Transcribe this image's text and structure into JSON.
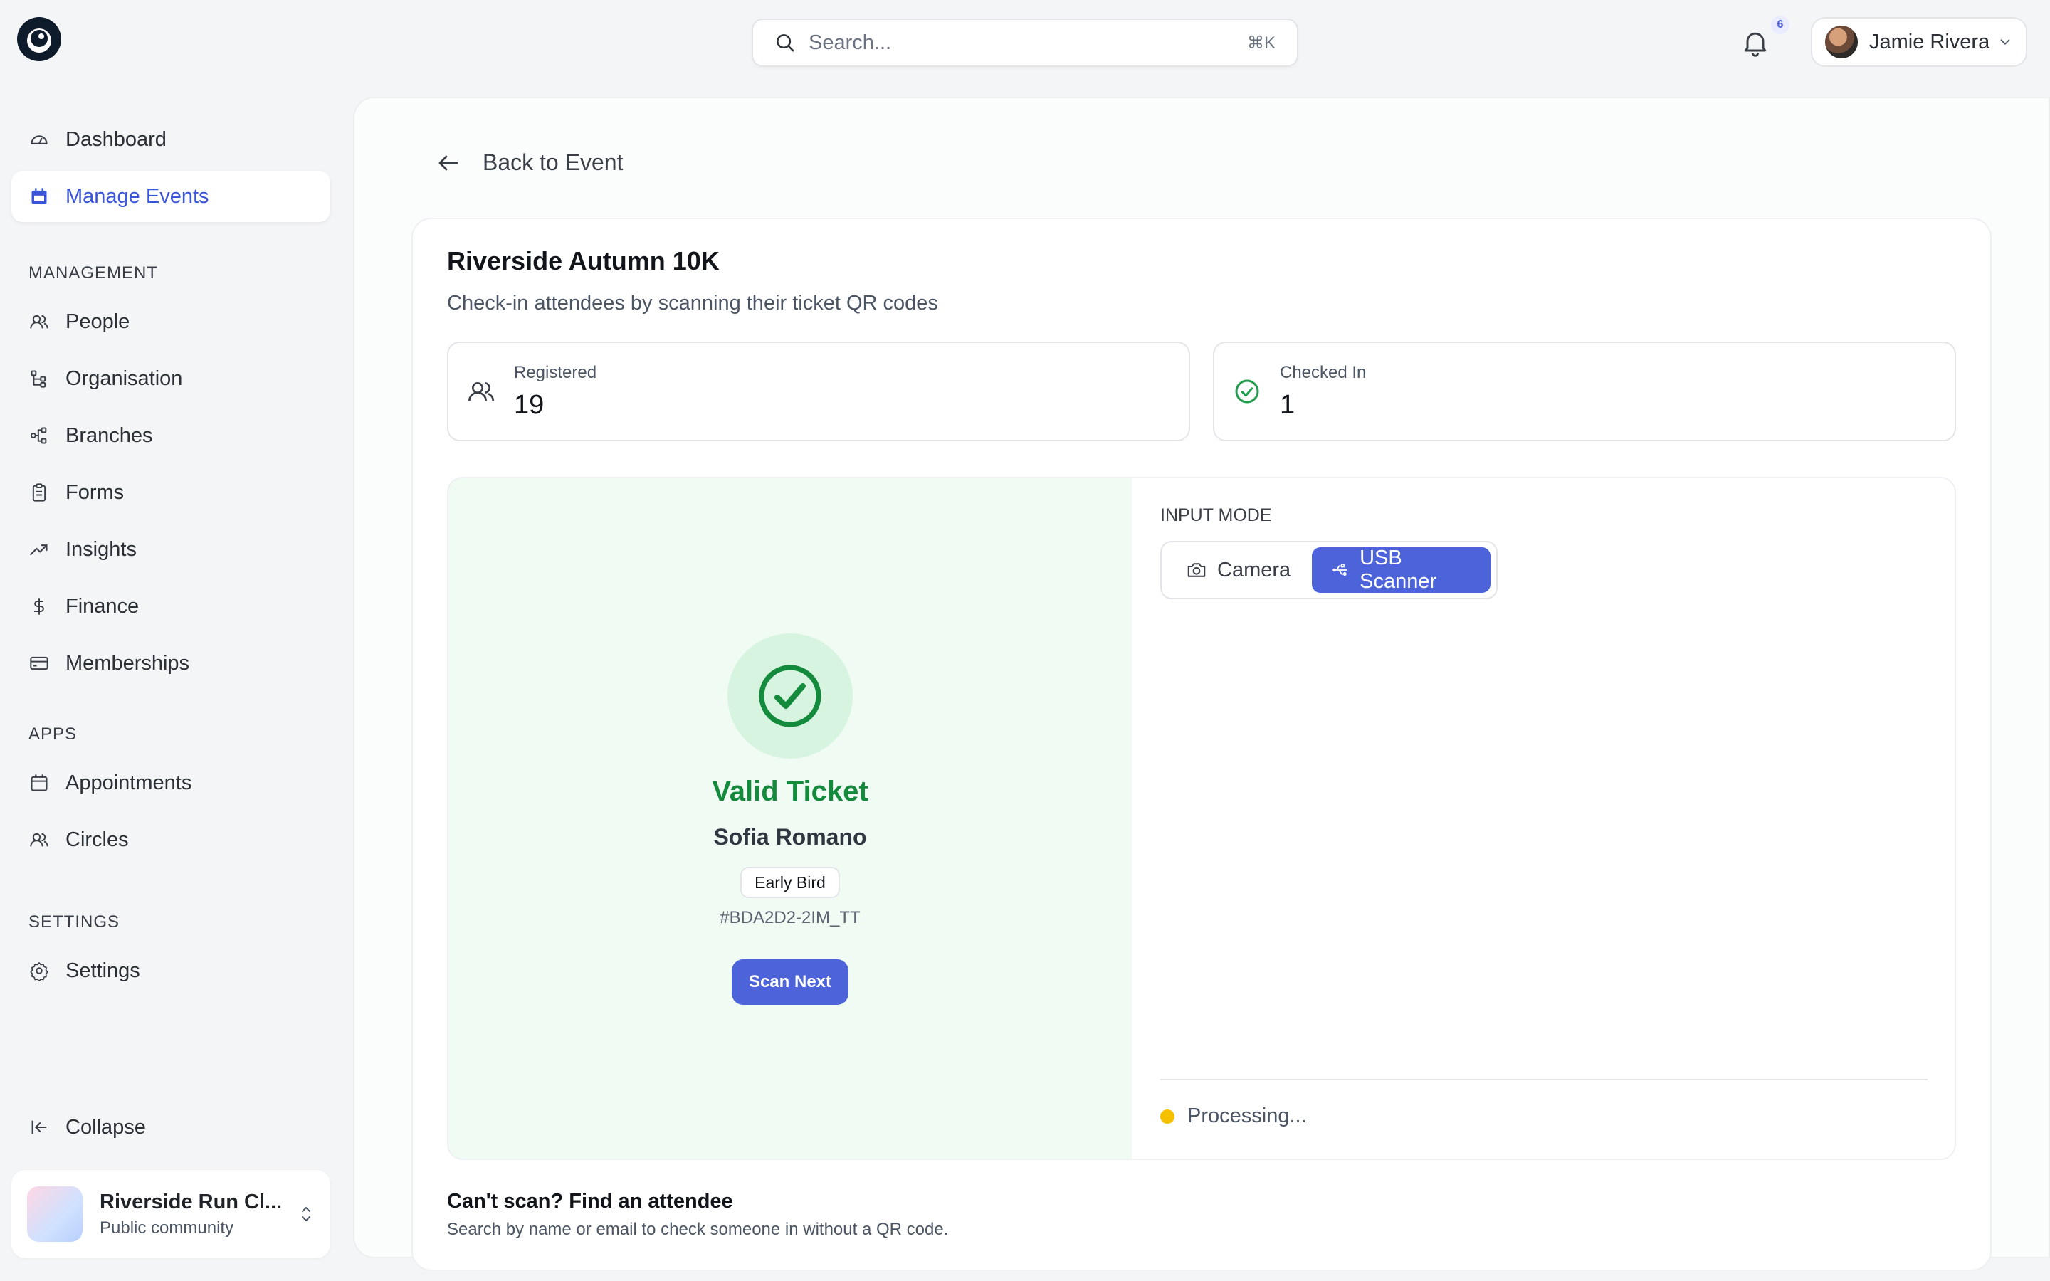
{
  "header": {
    "search_placeholder": "Search...",
    "search_shortcut": "⌘K",
    "notification_count": "6",
    "user_name": "Jamie Rivera"
  },
  "sidebar": {
    "top_items": [
      {
        "label": "Dashboard",
        "icon": "gauge-icon"
      },
      {
        "label": "Manage Events",
        "icon": "calendar-icon",
        "active": true
      }
    ],
    "sections": [
      {
        "title": "MANAGEMENT",
        "items": [
          {
            "label": "People",
            "icon": "users-icon"
          },
          {
            "label": "Organisation",
            "icon": "org-icon"
          },
          {
            "label": "Branches",
            "icon": "branches-icon"
          },
          {
            "label": "Forms",
            "icon": "clipboard-icon"
          },
          {
            "label": "Insights",
            "icon": "trend-icon"
          },
          {
            "label": "Finance",
            "icon": "dollar-icon"
          },
          {
            "label": "Memberships",
            "icon": "card-icon"
          }
        ]
      },
      {
        "title": "APPS",
        "items": [
          {
            "label": "Appointments",
            "icon": "calendar-icon"
          },
          {
            "label": "Circles",
            "icon": "users-icon"
          }
        ]
      },
      {
        "title": "SETTINGS",
        "items": [
          {
            "label": "Settings",
            "icon": "gear-icon"
          }
        ]
      }
    ],
    "collapse_label": "Collapse",
    "community": {
      "name": "Riverside Run Cl...",
      "type": "Public community"
    }
  },
  "main": {
    "back_label": "Back to Event",
    "event_title": "Riverside Autumn 10K",
    "event_subtitle": "Check-in attendees by scanning their ticket QR codes",
    "stats": [
      {
        "label": "Registered",
        "value": "19"
      },
      {
        "label": "Checked In",
        "value": "1"
      }
    ],
    "result": {
      "status": "Valid Ticket",
      "attendee": "Sofia Romano",
      "tier": "Early Bird",
      "ticket_id": "#BDA2D2-2IM_TT",
      "next_label": "Scan Next",
      "accent": "#148a3c"
    },
    "input_mode": {
      "label": "INPUT MODE",
      "options": [
        "Camera",
        "USB Scanner"
      ],
      "selected": "USB Scanner"
    },
    "processing_label": "Processing...",
    "find": {
      "title": "Can't scan? Find an attendee",
      "subtitle": "Search by name or email to check someone in without a QR code."
    }
  },
  "colors": {
    "primary": "#4c63d9",
    "success": "#148a3c",
    "warning": "#f5c000"
  }
}
